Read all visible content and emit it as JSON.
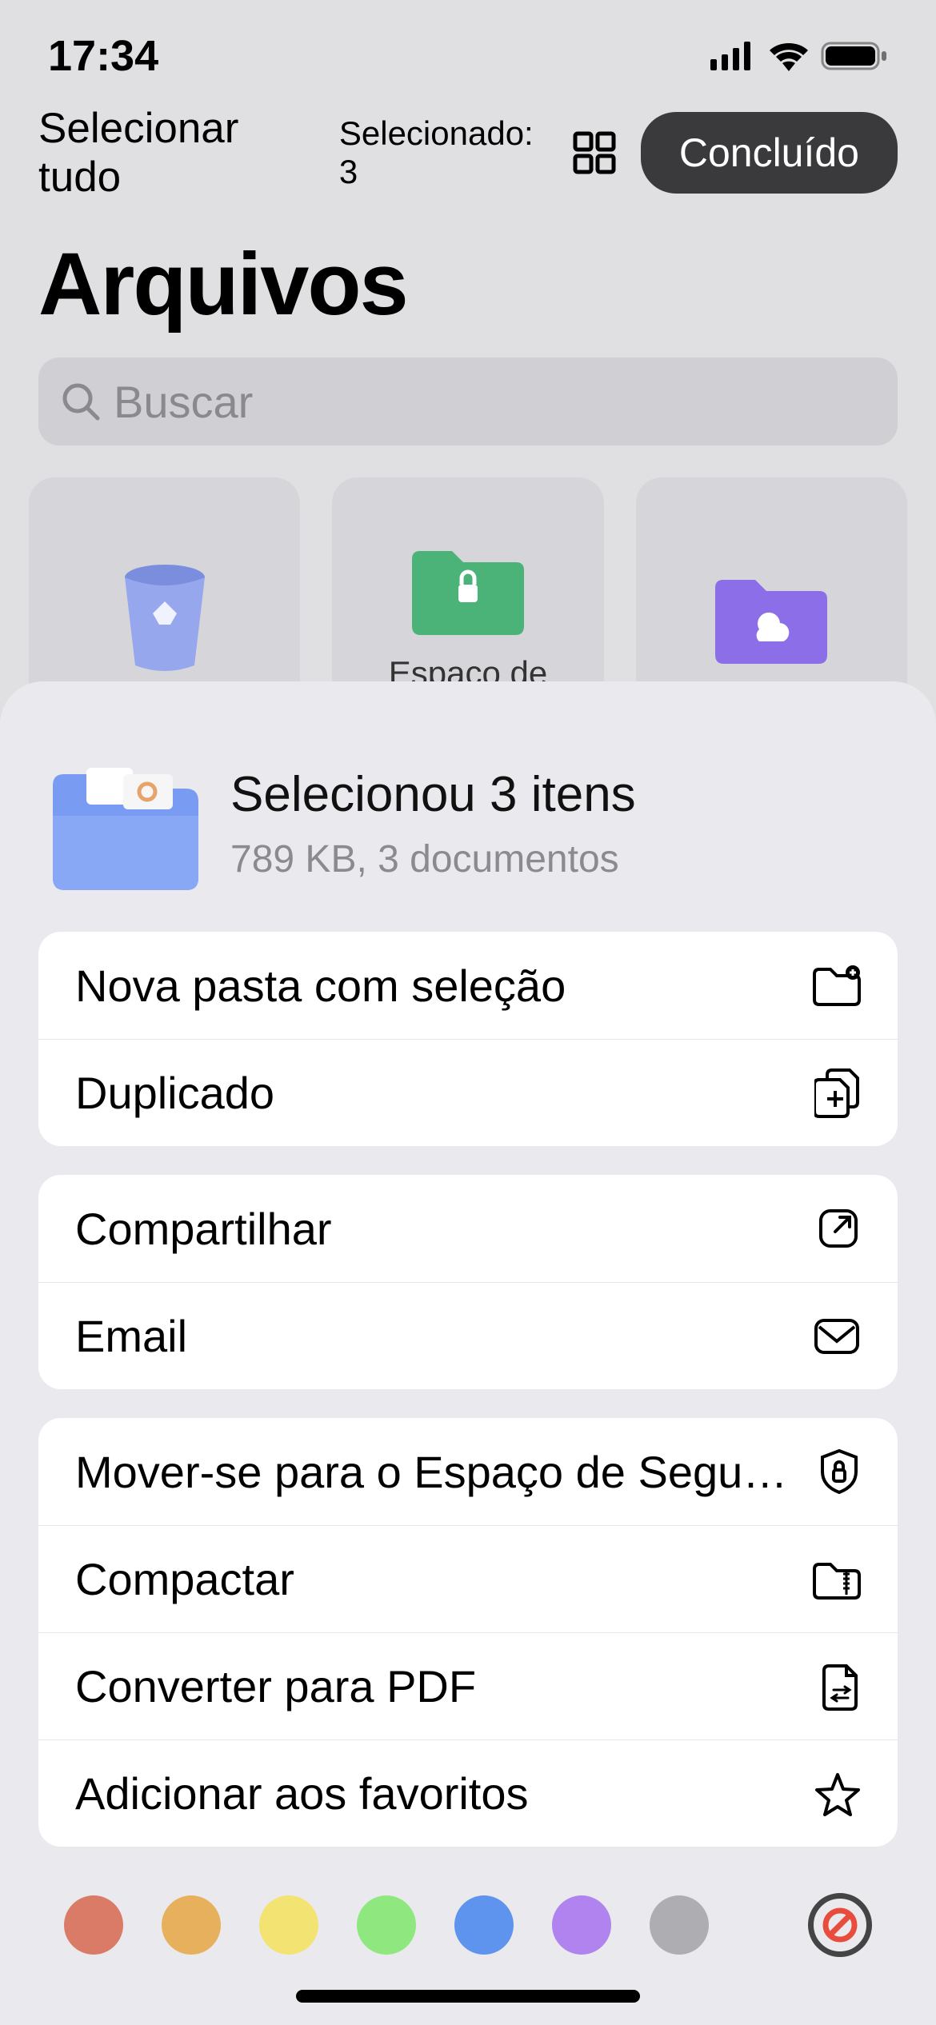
{
  "status": {
    "time": "17:34"
  },
  "toolbar": {
    "select_all": "Selecionar tudo",
    "selected_count": "Selecionado: 3",
    "done": "Concluído"
  },
  "page_title": "Arquivos",
  "search": {
    "placeholder": "Buscar"
  },
  "tiles": {
    "tile2_label_partial": "Espaço de"
  },
  "sheet": {
    "title": "Selecionou 3 itens",
    "subtitle": "789 KB, 3 documentos",
    "actions": {
      "new_folder": "Nova pasta com seleção",
      "duplicate": "Duplicado",
      "share": "Compartilhar",
      "email": "Email",
      "move_secure": "Mover-se para o Espaço de Seguran...",
      "compress": "Compactar",
      "convert_pdf": "Converter para PDF",
      "add_favorites": "Adicionar aos favoritos"
    }
  },
  "colors": {
    "red": "#d97b66",
    "orange": "#e7b05d",
    "yellow": "#f2e373",
    "green": "#8ee87f",
    "blue": "#5f94ee",
    "purple": "#b183ee",
    "gray": "#aeaeb2"
  }
}
